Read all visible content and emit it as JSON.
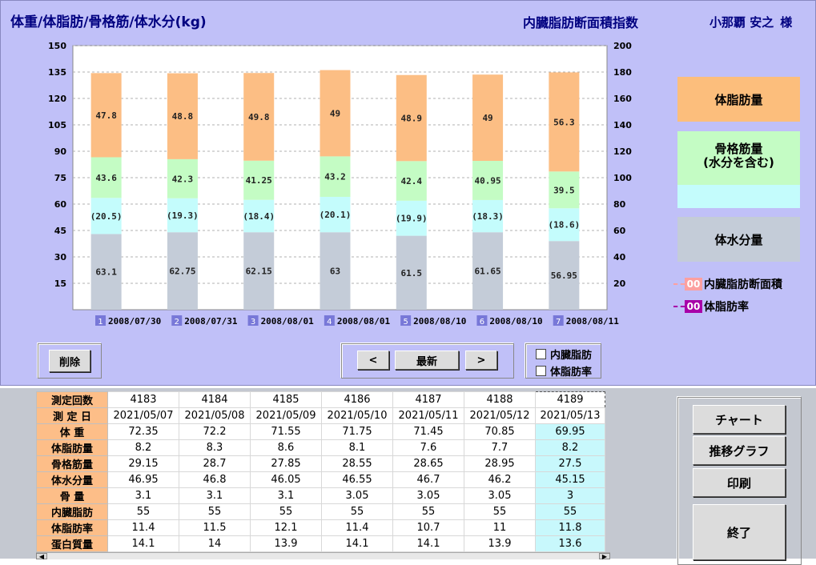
{
  "header": {
    "title": "体重/体脂肪/骨格筋/体水分(kg)",
    "subtitle": "内臓脂肪断面積指数",
    "user_name": "小那覇 安之",
    "user_suffix": "様"
  },
  "chart_data": {
    "type": "bar",
    "stacked": true,
    "left_axis": {
      "ticks": [
        15,
        30,
        45,
        60,
        75,
        90,
        105,
        120,
        135,
        150
      ],
      "ylim": [
        0,
        150
      ]
    },
    "right_axis": {
      "ticks": [
        20,
        40,
        60,
        80,
        100,
        120,
        140,
        160,
        180,
        200
      ],
      "ylim": [
        0,
        200
      ]
    },
    "grid": true,
    "categories": [
      "2008/07/30",
      "2008/07/31",
      "2008/08/01",
      "2008/08/01",
      "2008/08/10",
      "2008/08/10",
      "2008/08/11"
    ],
    "category_indices": [
      "1",
      "2",
      "3",
      "4",
      "5",
      "6",
      "7"
    ],
    "series": [
      {
        "name": "体水分量",
        "color": "#c4ccd8",
        "values": [
          43,
          44,
          44,
          44,
          42,
          44,
          39
        ],
        "labels": [
          "63.1",
          "62.75",
          "62.15",
          "63",
          "61.5",
          "61.65",
          "56.95"
        ]
      },
      {
        "name": "水分",
        "color": "#c4fcfc",
        "values": [
          20.5,
          19.3,
          18.4,
          20.1,
          19.9,
          18.3,
          18.6
        ],
        "labels": [
          "(20.5)",
          "(19.3)",
          "(18.4)",
          "(20.1)",
          "(19.9)",
          "(18.3)",
          "(18.6)"
        ]
      },
      {
        "name": "骨格筋量",
        "color": "#c4fcc4",
        "values": [
          23.1,
          22.2,
          22.25,
          23.0,
          22.5,
          22.25,
          20.9
        ],
        "labels": [
          "43.6",
          "42.3",
          "41.25",
          "43.2",
          "42.4",
          "40.95",
          "39.5"
        ]
      },
      {
        "name": "体脂肪量",
        "color": "#fcbe84",
        "values": [
          47.8,
          48.8,
          49.8,
          49,
          48.9,
          49,
          56.3
        ],
        "labels": [
          "47.8",
          "48.8",
          "49.8",
          "49",
          "48.9",
          "49",
          "56.3"
        ]
      }
    ]
  },
  "legend": {
    "fat": "体脂肪量",
    "muscle": "骨格筋量\n(水分を含む)",
    "water": "体水分量",
    "visceral_tag": "00",
    "visceral_label": "内臓脂肪断面積",
    "fatrate_tag": "00",
    "fatrate_label": "体脂肪率",
    "fat_color": "#fcbe7c",
    "muscle_color": "#c4fcc4",
    "water_color": "#c4ccd8",
    "visceral_color": "#fca0a0",
    "fatrate_color": "#a800a8"
  },
  "controls": {
    "delete": "削除",
    "prev": "<",
    "latest": "最新",
    "next": ">",
    "chk_visceral": "内臓脂肪",
    "chk_fatrate": "体脂肪率"
  },
  "table": {
    "row_headers": [
      "測定回数",
      "測 定 日",
      "体    重",
      "体脂肪量",
      "骨格筋量",
      "体水分量",
      "骨    量",
      "内臓脂肪",
      "体脂肪率",
      "蛋白質量"
    ],
    "columns": [
      [
        "4183",
        "2021/05/07",
        "72.35",
        "8.2",
        "29.15",
        "46.95",
        "3.1",
        "55",
        "11.4",
        "14.1"
      ],
      [
        "4184",
        "2021/05/08",
        "72.2",
        "8.3",
        "28.7",
        "46.8",
        "3.1",
        "55",
        "11.5",
        "14"
      ],
      [
        "4185",
        "2021/05/09",
        "71.55",
        "8.6",
        "27.85",
        "46.05",
        "3.1",
        "55",
        "12.1",
        "13.9"
      ],
      [
        "4186",
        "2021/05/10",
        "71.75",
        "8.1",
        "28.55",
        "46.55",
        "3.05",
        "55",
        "11.4",
        "14.1"
      ],
      [
        "4187",
        "2021/05/11",
        "71.45",
        "7.6",
        "28.65",
        "46.7",
        "3.05",
        "55",
        "10.7",
        "14.1"
      ],
      [
        "4188",
        "2021/05/12",
        "70.85",
        "7.7",
        "28.95",
        "46.2",
        "3.05",
        "55",
        "11",
        "13.9"
      ],
      [
        "4189",
        "2021/05/13",
        "69.95",
        "8.2",
        "27.5",
        "45.15",
        "3",
        "55",
        "11.8",
        "13.6"
      ]
    ]
  },
  "side_buttons": {
    "chart": "チャート",
    "trend": "推移グラフ",
    "print": "印刷",
    "exit": "終了"
  }
}
